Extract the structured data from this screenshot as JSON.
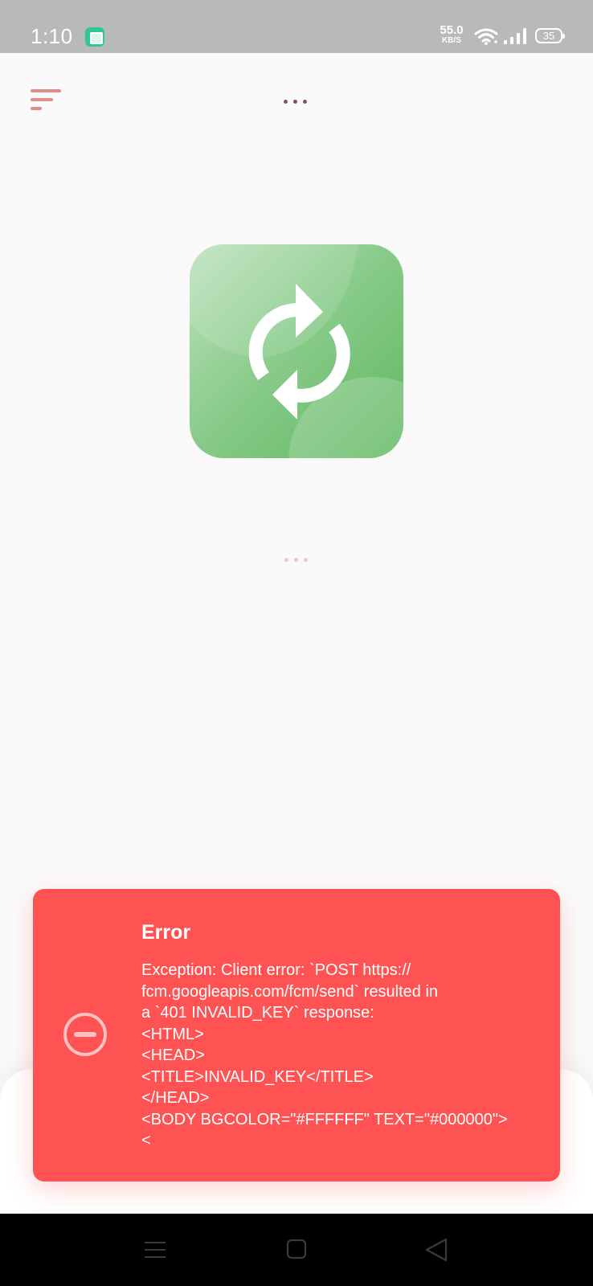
{
  "status_bar": {
    "time": "1:10",
    "net_speed": "55.0",
    "net_unit": "KB/S",
    "battery": "35"
  },
  "icons": {
    "menu": "sort-menu-icon",
    "more": "more-horizontal-icon",
    "app": "sync-refresh-icon",
    "error": "minus-circle-icon"
  },
  "colors": {
    "accent": "#e08d88",
    "error_bg": "#ff5353",
    "app_icon_green": "#5fb760"
  },
  "toast": {
    "title": "Error",
    "message": "Exception: Client error: `POST https://\nfcm.googleapis.com/fcm/send` resulted in\na `401 INVALID_KEY` response:\n<HTML>\n<HEAD>\n<TITLE>INVALID_KEY</TITLE>\n</HEAD>\n<BODY BGCOLOR=\"#FFFFFF\" TEXT=\"#000000\">\n<"
  },
  "nav": {
    "recents": "recents-icon",
    "home": "home-icon",
    "back": "back-icon"
  }
}
